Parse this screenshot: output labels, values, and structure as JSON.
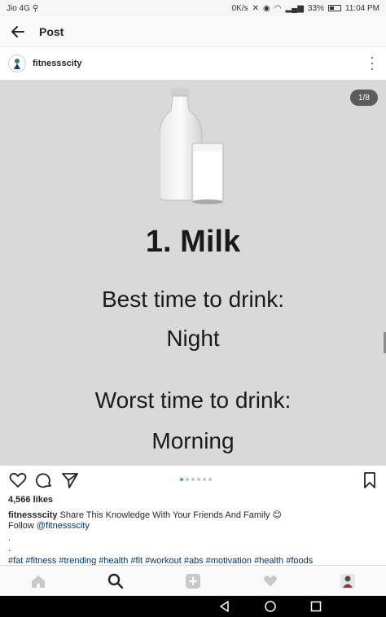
{
  "status_bar": {
    "carrier": "Jio 4G",
    "network_speed": "0K/s",
    "battery": "33%",
    "time": "11:04 PM"
  },
  "nav": {
    "title": "Post"
  },
  "post": {
    "username": "fitnessscity",
    "counter": "1/8",
    "image_text": {
      "title": "1. Milk",
      "line1": "Best time to drink:",
      "line2": "Night",
      "line3": "Worst time to drink:",
      "line4": "Morning"
    },
    "carousel_count": 6,
    "carousel_active": 0,
    "likes": "4,566 likes",
    "caption_user": "fitnessscity",
    "caption_text": "Share This Knowledge With Your Friends And Family 😊",
    "follow_label": "Follow",
    "follow_handle": "@fitnessscity",
    "period1": ".",
    "period2": ".",
    "hashtags": "#fat #fitness #trending #health #fit #workout #abs #motivation #health #foods"
  },
  "colors": {
    "accent": "#3897f0",
    "link": "#003569",
    "image_bg": "#d9d9d9"
  },
  "icons": {
    "back": "arrow-left-icon",
    "more": "more-vertical-icon",
    "like": "heart-icon",
    "comment": "comment-icon",
    "share": "direct-share-icon",
    "save": "bookmark-icon",
    "home": "home-icon",
    "search": "search-icon",
    "add": "add-post-icon",
    "activity": "heart-icon",
    "profile": "profile-avatar-icon"
  }
}
